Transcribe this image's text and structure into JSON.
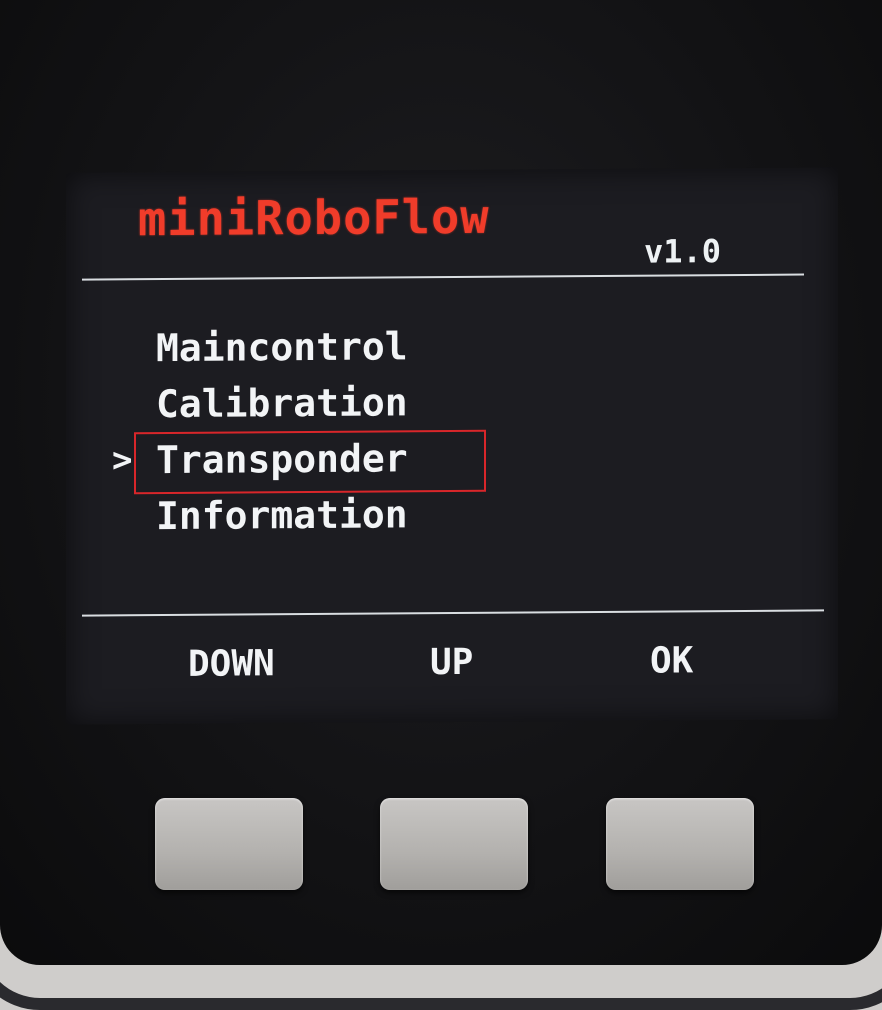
{
  "screen": {
    "title": "miniRoboFlow",
    "version": "v1.0",
    "menu": {
      "items": [
        {
          "label": "Maincontrol"
        },
        {
          "label": "Calibration"
        },
        {
          "label": "Transponder"
        },
        {
          "label": "Information"
        }
      ],
      "selected_index": 2,
      "cursor_glyph": ">"
    },
    "softkeys": {
      "down": "DOWN",
      "up": "UP",
      "ok": "OK"
    }
  },
  "colors": {
    "title": "#f03c2a",
    "text": "#f2f4f6",
    "screen_bg": "#1c1c21",
    "highlight_border": "#d8262a"
  }
}
